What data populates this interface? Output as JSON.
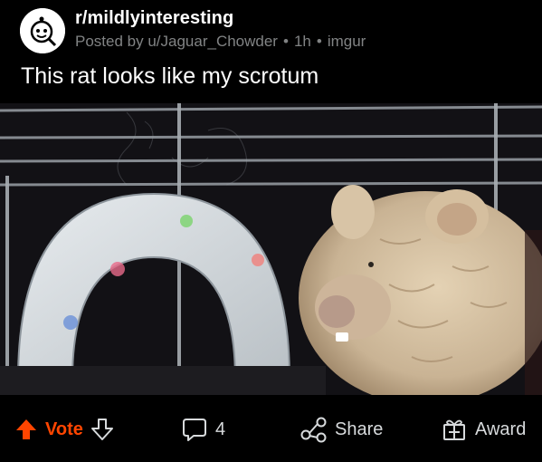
{
  "post": {
    "subreddit": "r/mildlyinteresting",
    "author": "Posted by u/Jaguar_Chowder",
    "time": "1h",
    "source": "imgur",
    "separator": "•",
    "title": "This rat looks like my scrotum"
  },
  "actions": {
    "vote_label": "Vote",
    "comment_count": "4",
    "share_label": "Share",
    "award_label": "Award"
  },
  "colors": {
    "background": "#000000",
    "upvote": "#ff4500",
    "text": "#d7dadc",
    "meta": "#818384"
  },
  "icons": [
    "subreddit-avatar-icon",
    "upvote-arrow-icon",
    "downvote-arrow-icon",
    "comment-bubble-icon",
    "share-icon",
    "award-gift-icon"
  ]
}
